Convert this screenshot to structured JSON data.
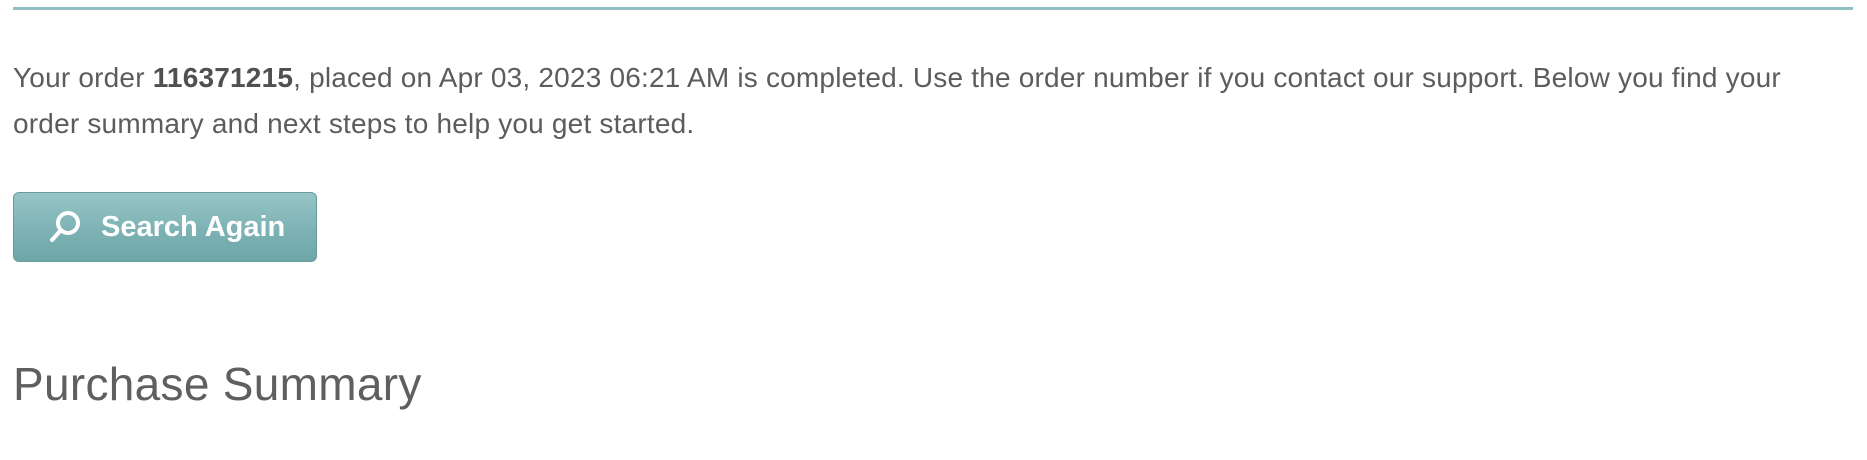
{
  "order_message": {
    "prefix": "Your order ",
    "order_number": "116371215",
    "suffix": ", placed on Apr 03, 2023 06:21 AM is completed. Use the order number if you contact our support. Below you find your order summary and next steps to help you get started."
  },
  "search_button": {
    "label": "Search Again",
    "icon": "search-icon"
  },
  "purchase_summary": {
    "title": "Purchase Summary"
  },
  "colors": {
    "accent": "#7db2b4",
    "rule": "#8fbfc0",
    "text": "#5c5c5c"
  }
}
